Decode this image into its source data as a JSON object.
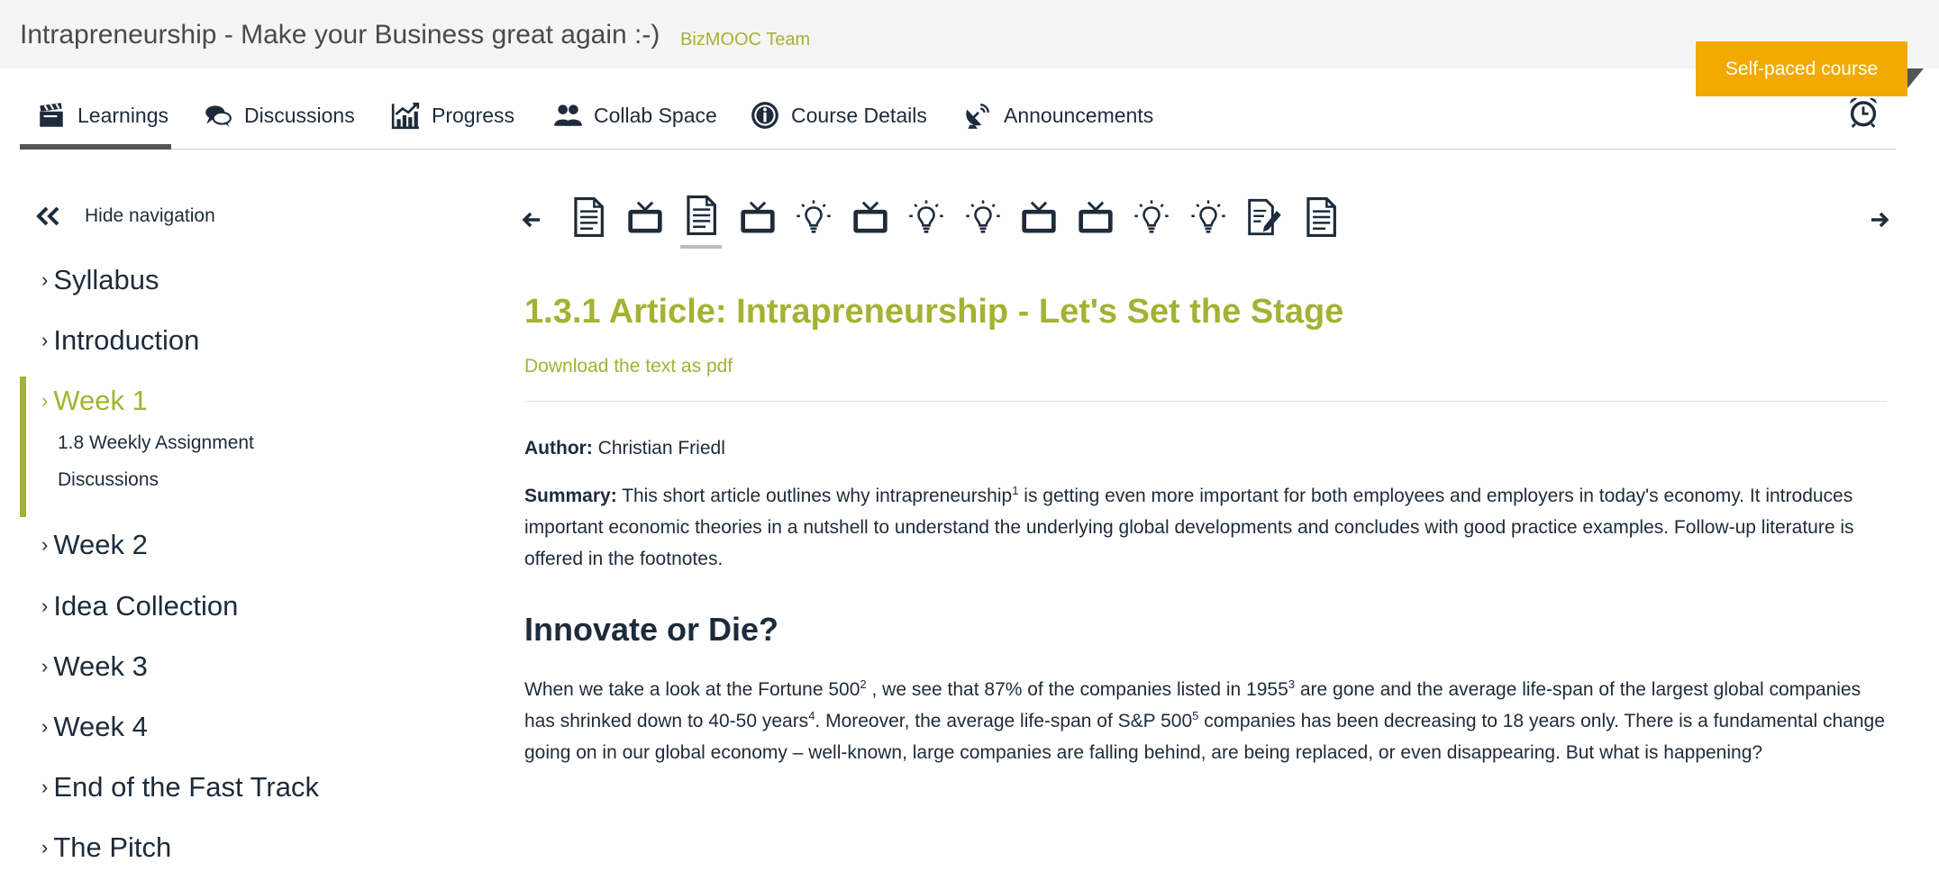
{
  "course": {
    "title": "Intrapreneurship - Make your Business great again :-)",
    "team": "BizMOOC Team",
    "badge": "Self-paced course"
  },
  "tabs": [
    {
      "label": "Learnings",
      "icon": "clapperboard-icon"
    },
    {
      "label": "Discussions",
      "icon": "speech-bubbles-icon"
    },
    {
      "label": "Progress",
      "icon": "chart-icon"
    },
    {
      "label": "Collab Space",
      "icon": "people-icon"
    },
    {
      "label": "Course Details",
      "icon": "info-icon"
    },
    {
      "label": "Announcements",
      "icon": "satellite-dish-icon"
    }
  ],
  "sidebar": {
    "hide_label": "Hide navigation",
    "items": [
      {
        "label": "Syllabus"
      },
      {
        "label": "Introduction"
      },
      {
        "label": "Week 1"
      },
      {
        "label": "Week 2"
      },
      {
        "label": "Idea Collection"
      },
      {
        "label": "Week 3"
      },
      {
        "label": "Week 4"
      },
      {
        "label": "End of the Fast Track"
      },
      {
        "label": "The Pitch"
      }
    ],
    "week1_sub": [
      "1.8 Weekly Assignment",
      "Discussions"
    ]
  },
  "item_nav": {
    "icons": [
      "document-icon",
      "video-icon",
      "document-icon",
      "video-icon",
      "lightbulb-icon",
      "video-icon",
      "lightbulb-icon",
      "lightbulb-icon",
      "video-icon",
      "video-icon",
      "lightbulb-icon",
      "lightbulb-icon",
      "assignment-icon",
      "document-icon"
    ],
    "current_index": 2
  },
  "article": {
    "title": "1.3.1 Article: Intrapreneurship - Let's Set the Stage",
    "pdf_link": "Download the text as pdf",
    "author_label": "Author:",
    "author": "Christian Friedl",
    "summary_label": "Summary:",
    "summary_a": "This short article outlines why intrapreneurship",
    "summary_sup": "1",
    "summary_b": "is getting even more important for both employees and employers in today's economy. It introduces important economic theories in a nutshell to understand the underlying global developments and concludes with good practice examples. Follow-up literature is offered in the footnotes.",
    "heading": "Innovate or Die?",
    "p1_a": "When we take a look at the Fortune 500",
    "p1_sup1": "2",
    "p1_b": ", we see that 87% of the companies listed in 1955",
    "p1_sup2": "3",
    "p1_c": "are gone and the average life-span of the largest global companies has shrinked down to 40-50 years",
    "p1_sup3": "4",
    "p1_d": ". Moreover, the average life-span of S&P 500",
    "p1_sup4": "5",
    "p1_e": "companies has been decreasing to 18 years only. There is a fundamental change going on in our global economy – well-known, large companies are falling behind, are being replaced, or even disappearing. But what is happening?"
  },
  "colors": {
    "accent": "#a4b233",
    "badge": "#f2a900",
    "text": "#1d2b3a"
  }
}
